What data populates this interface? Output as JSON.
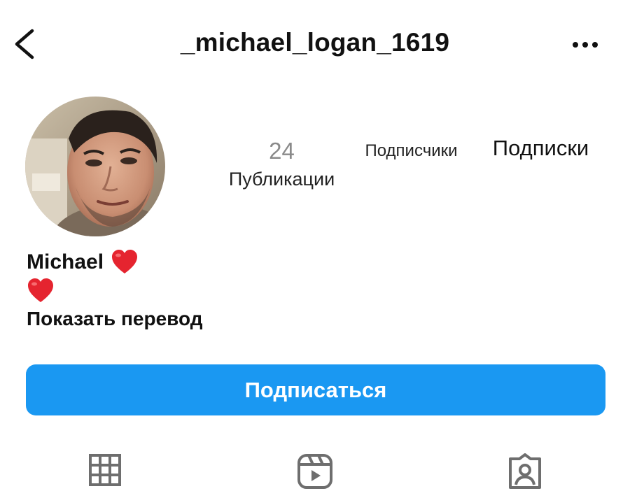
{
  "header": {
    "username": "_michael_logan_1619",
    "back_icon": "chevron-left-icon",
    "more_icon": "more-horizontal-icon"
  },
  "profile": {
    "avatar": "profile-photo",
    "stats": {
      "posts_count": "24",
      "posts_label": "Публикации",
      "followers_label": "Подписчики",
      "following_label": "Подписки"
    },
    "bio": {
      "name": "Michael",
      "translate_link": "Показать перевод"
    }
  },
  "actions": {
    "follow_label": "Подписаться"
  },
  "tabs": [
    {
      "icon": "grid-icon"
    },
    {
      "icon": "reels-icon"
    },
    {
      "icon": "tagged-icon"
    }
  ],
  "colors": {
    "accent": "#1a98f2",
    "heart": "#e5242f",
    "icon_gray": "#6e6e6e"
  }
}
